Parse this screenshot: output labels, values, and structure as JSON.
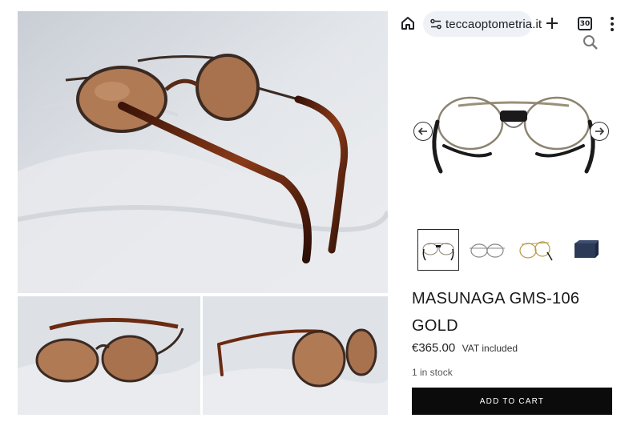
{
  "browser": {
    "url": "teccaoptometria.it",
    "tab_count": "30",
    "icons": [
      "home-icon",
      "site-settings-icon",
      "plus-icon",
      "tab-switcher-icon",
      "more-vert-icon",
      "search-icon"
    ]
  },
  "gallery": {
    "nav_icons": [
      "arrow-left-icon",
      "arrow-right-icon"
    ],
    "thumbnail_count": 4,
    "selected_thumbnail": 1
  },
  "product": {
    "title": "MASUNAGA GMS-106 GOLD",
    "price": "€365.00",
    "vat_note": "VAT included",
    "stock": "1 in stock",
    "add_to_cart_label": "ADD TO CART"
  },
  "colors": {
    "button_bg": "#0b0b0b",
    "lens_tint": "#b07a55",
    "tortoise_temple": "#6b2a12"
  }
}
